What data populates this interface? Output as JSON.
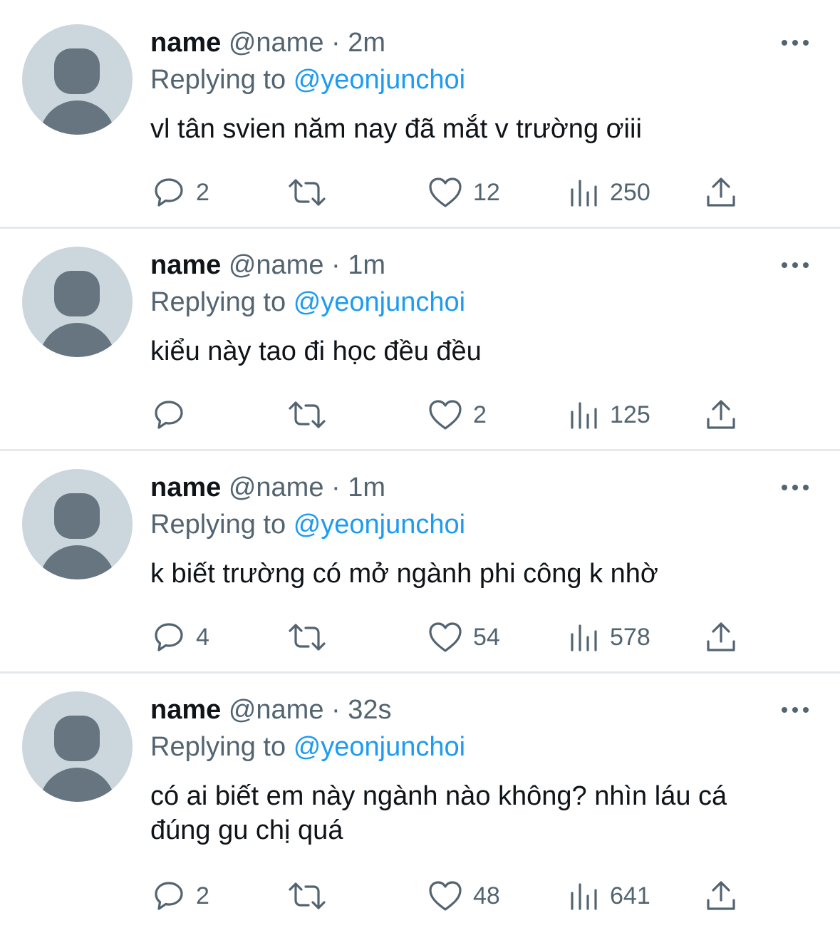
{
  "icons": {
    "avatar": "default-avatar-icon",
    "more": "more-horizontal-icon",
    "reply": "reply-bubble-icon",
    "retweet": "retweet-icon",
    "like": "heart-icon",
    "views": "bar-chart-icon",
    "share": "share-upload-icon"
  },
  "colors": {
    "text": "#0f1419",
    "muted": "#536471",
    "accent": "#1d9bf0",
    "avatar_bg": "#ccd6dd",
    "divider": "#e6e9ec"
  },
  "tweets": [
    {
      "name": "name",
      "handle": "@name",
      "separator": "·",
      "time": "2m",
      "replying_label": "Replying to",
      "replying_to": "@yeonjunchoi",
      "text": "vl tân svien năm nay đã mắt v trường ơiii",
      "replies": "2",
      "retweets": "",
      "likes": "12",
      "views": "250"
    },
    {
      "name": "name",
      "handle": "@name",
      "separator": "·",
      "time": "1m",
      "replying_label": "Replying to",
      "replying_to": "@yeonjunchoi",
      "text": "kiểu này tao đi học đều đều",
      "replies": "",
      "retweets": "",
      "likes": "2",
      "views": "125"
    },
    {
      "name": "name",
      "handle": "@name",
      "separator": "·",
      "time": "1m",
      "replying_label": "Replying to",
      "replying_to": "@yeonjunchoi",
      "text": "k biết trường có mở ngành phi công k nhờ",
      "replies": "4",
      "retweets": "",
      "likes": "54",
      "views": "578"
    },
    {
      "name": "name",
      "handle": "@name",
      "separator": "·",
      "time": "32s",
      "replying_label": "Replying to",
      "replying_to": "@yeonjunchoi",
      "text": "có ai biết em này ngành nào không? nhìn láu cá đúng gu chị quá",
      "replies": "2",
      "retweets": "",
      "likes": "48",
      "views": "641"
    }
  ]
}
